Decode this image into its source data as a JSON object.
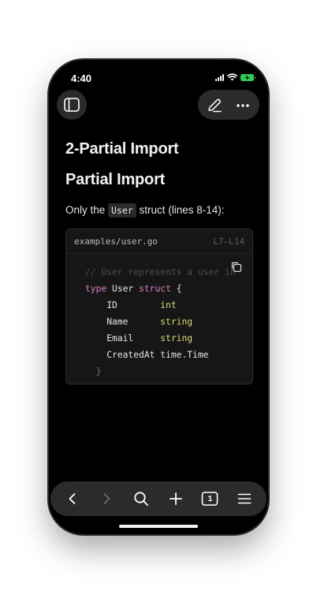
{
  "status_bar": {
    "time": "4:40"
  },
  "content": {
    "heading1": "2-Partial Import",
    "heading2": "Partial Import",
    "paragraph_prefix": "Only the",
    "paragraph_code": "User",
    "paragraph_suffix": "struct (lines 8-14):"
  },
  "code_block": {
    "filename": "examples/user.go",
    "line_range": "L7–L14",
    "lines": [
      {
        "comment": "// User represents a user in"
      },
      {
        "kw1": "type",
        "name": "User",
        "kw2": "struct",
        "brace": "{"
      },
      {
        "field": "ID",
        "type": "int"
      },
      {
        "field": "Name",
        "type": "string"
      },
      {
        "field": "Email",
        "type": "string"
      },
      {
        "field": "CreatedAt",
        "type": "time.Time"
      },
      {
        "brace": "}"
      }
    ]
  },
  "colors": {
    "background": "#000000",
    "surface": "#2b2b2e",
    "keyword": "#d580c0",
    "type": "#d9dc7a",
    "battery": "#34c759"
  },
  "icons": {
    "sidebar": "sidebar-icon",
    "edit": "pencil-icon",
    "more": "ellipsis-icon",
    "copy": "copy-icon",
    "back": "chevron-left-icon",
    "forward": "chevron-right-icon",
    "search": "search-icon",
    "add": "plus-icon",
    "tabs": "tabs-icon",
    "menu": "menu-icon"
  },
  "toolbar": {
    "tab_count": "1"
  }
}
